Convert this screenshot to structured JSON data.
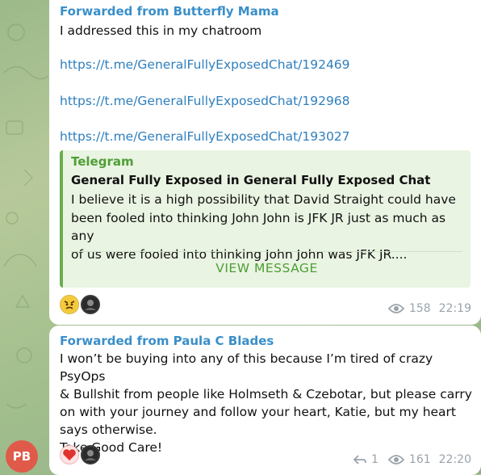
{
  "messages": [
    {
      "forwarded_from": "Forwarded from Butterfly Mama",
      "text": "I addressed this in my chatroom",
      "links": [
        "https://t.me/GeneralFullyExposedChat/192469",
        "https://t.me/GeneralFullyExposedChat/192968",
        "https://t.me/GeneralFullyExposedChat/193027"
      ],
      "preview": {
        "site": "Telegram",
        "title": "General Fully Exposed in General Fully Exposed Chat",
        "description_lines": [
          "I believe it is a high possibility that David Straight could have",
          "been fooled into thinking John John is JFK JR just as much as any",
          "of us were fooled into thinking John John was JFK JR...."
        ],
        "button": "VIEW MESSAGE"
      },
      "reactions": [
        "angry-face-emoji",
        "user-avatar"
      ],
      "views": "158",
      "time": "22:19"
    },
    {
      "forwarded_from": "Forwarded from Paula C Blades",
      "text_lines": [
        "I won’t be buying into any of this because I’m tired of crazy PsyOps",
        "& Bullshit from people like Holmseth & Czebotar, but please carry",
        "on with your journey and follow your heart, Katie, but my heart",
        "says otherwise.",
        "Take Good Care!"
      ],
      "reactions": [
        "heart-emoji",
        "user-avatar"
      ],
      "replies": "1",
      "views": "161",
      "time": "22:20"
    }
  ],
  "sender_avatar": {
    "initials": "PB",
    "color": "#e05a4a"
  },
  "colors": {
    "link": "#2f7fbd",
    "forward_name": "#3a8fc9",
    "preview_accent": "#6aae4d"
  }
}
